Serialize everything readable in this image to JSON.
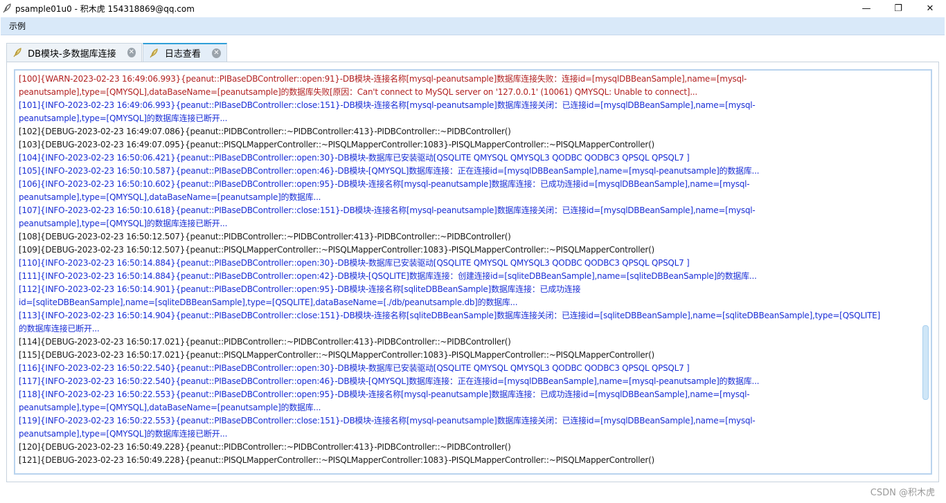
{
  "window": {
    "title": "psample01u0 - 积木虎  154318869@qq.com",
    "icon": "feather-icon",
    "controls": {
      "minimize": "—",
      "maximize": "❐",
      "close": "✕"
    }
  },
  "menubar": {
    "items": [
      {
        "label": "示例"
      }
    ]
  },
  "tabs": [
    {
      "label": "DB模块-多数据库连接",
      "icon": "feather-icon",
      "active": false
    },
    {
      "label": "日志查看",
      "icon": "feather-icon",
      "active": true
    }
  ],
  "log": {
    "lines": [
      {
        "level": "WARN",
        "text": "[100]{WARN-2023-02-23 16:49:06.993}{peanut::PIBaseDBController::open:91}-DB模块-连接名称[mysql-peanutsample]数据库连接失败：连接id=[mysqlDBBeanSample],name=[mysql-"
      },
      {
        "level": "WARN",
        "text": "peanutsample],type=[QMYSQL],dataBaseName=[peanutsample]的数据库失败[原因：Can't connect to MySQL server on '127.0.0.1' (10061) QMYSQL: Unable to connect]..."
      },
      {
        "level": "INFO",
        "text": "[101]{INFO-2023-02-23 16:49:06.993}{peanut::PIBaseDBController::close:151}-DB模块-连接名称[mysql-peanutsample]数据库连接关闭：已连接id=[mysqlDBBeanSample],name=[mysql-"
      },
      {
        "level": "INFO",
        "text": "peanutsample],type=[QMYSQL]的数据库连接已断开..."
      },
      {
        "level": "DEBUG",
        "text": "[102]{DEBUG-2023-02-23 16:49:07.086}{peanut::PIDBController::~PIDBController:413}-PIDBController::~PIDBController()"
      },
      {
        "level": "DEBUG",
        "text": "[103]{DEBUG-2023-02-23 16:49:07.095}{peanut::PISQLMapperController::~PISQLMapperController:1083}-PISQLMapperController::~PISQLMapperController()"
      },
      {
        "level": "INFO",
        "text": "[104]{INFO-2023-02-23 16:50:06.421}{peanut::PIBaseDBController::open:30}-DB模块-数据库已安装驱动[QSQLITE QMYSQL QMYSQL3 QODBC QODBC3 QPSQL QPSQL7 ]"
      },
      {
        "level": "INFO",
        "text": "[105]{INFO-2023-02-23 16:50:10.587}{peanut::PIBaseDBController::open:46}-DB模块-[QMYSQL]数据库连接：正在连接id=[mysqlDBBeanSample],name=[mysql-peanutsample]的数据库..."
      },
      {
        "level": "INFO",
        "text": "[106]{INFO-2023-02-23 16:50:10.602}{peanut::PIBaseDBController::open:95}-DB模块-连接名称[mysql-peanutsample]数据库连接：已成功连接id=[mysqlDBBeanSample],name=[mysql-"
      },
      {
        "level": "INFO",
        "text": "peanutsample],type=[QMYSQL],dataBaseName=[peanutsample]的数据库..."
      },
      {
        "level": "INFO",
        "text": "[107]{INFO-2023-02-23 16:50:10.618}{peanut::PIBaseDBController::close:151}-DB模块-连接名称[mysql-peanutsample]数据库连接关闭：已连接id=[mysqlDBBeanSample],name=[mysql-"
      },
      {
        "level": "INFO",
        "text": "peanutsample],type=[QMYSQL]的数据库连接已断开..."
      },
      {
        "level": "DEBUG",
        "text": "[108]{DEBUG-2023-02-23 16:50:12.507}{peanut::PIDBController::~PIDBController:413}-PIDBController::~PIDBController()"
      },
      {
        "level": "DEBUG",
        "text": "[109]{DEBUG-2023-02-23 16:50:12.507}{peanut::PISQLMapperController::~PISQLMapperController:1083}-PISQLMapperController::~PISQLMapperController()"
      },
      {
        "level": "INFO",
        "text": "[110]{INFO-2023-02-23 16:50:14.884}{peanut::PIBaseDBController::open:30}-DB模块-数据库已安装驱动[QSQLITE QMYSQL QMYSQL3 QODBC QODBC3 QPSQL QPSQL7 ]"
      },
      {
        "level": "INFO",
        "text": "[111]{INFO-2023-02-23 16:50:14.884}{peanut::PIBaseDBController::open:42}-DB模块-[QSQLITE]数据库连接：创建连接id=[sqliteDBBeanSample],name=[sqliteDBBeanSample]的数据库..."
      },
      {
        "level": "INFO",
        "text": "[112]{INFO-2023-02-23 16:50:14.901}{peanut::PIBaseDBController::open:95}-DB模块-连接名称[sqliteDBBeanSample]数据库连接：已成功连接"
      },
      {
        "level": "INFO",
        "text": "id=[sqliteDBBeanSample],name=[sqliteDBBeanSample],type=[QSQLITE],dataBaseName=[./db/peanutsample.db]的数据库..."
      },
      {
        "level": "INFO",
        "text": "[113]{INFO-2023-02-23 16:50:14.904}{peanut::PIBaseDBController::close:151}-DB模块-连接名称[sqliteDBBeanSample]数据库连接关闭：已连接id=[sqliteDBBeanSample],name=[sqliteDBBeanSample],type=[QSQLITE]"
      },
      {
        "level": "INFO",
        "text": "的数据库连接已断开..."
      },
      {
        "level": "DEBUG",
        "text": "[114]{DEBUG-2023-02-23 16:50:17.021}{peanut::PIDBController::~PIDBController:413}-PIDBController::~PIDBController()"
      },
      {
        "level": "DEBUG",
        "text": "[115]{DEBUG-2023-02-23 16:50:17.021}{peanut::PISQLMapperController::~PISQLMapperController:1083}-PISQLMapperController::~PISQLMapperController()"
      },
      {
        "level": "INFO",
        "text": "[116]{INFO-2023-02-23 16:50:22.540}{peanut::PIBaseDBController::open:30}-DB模块-数据库已安装驱动[QSQLITE QMYSQL QMYSQL3 QODBC QODBC3 QPSQL QPSQL7 ]"
      },
      {
        "level": "INFO",
        "text": "[117]{INFO-2023-02-23 16:50:22.540}{peanut::PIBaseDBController::open:46}-DB模块-[QMYSQL]数据库连接：正在连接id=[mysqlDBBeanSample],name=[mysql-peanutsample]的数据库..."
      },
      {
        "level": "INFO",
        "text": "[118]{INFO-2023-02-23 16:50:22.553}{peanut::PIBaseDBController::open:95}-DB模块-连接名称[mysql-peanutsample]数据库连接：已成功连接id=[mysqlDBBeanSample],name=[mysql-"
      },
      {
        "level": "INFO",
        "text": "peanutsample],type=[QMYSQL],dataBaseName=[peanutsample]的数据库..."
      },
      {
        "level": "INFO",
        "text": "[119]{INFO-2023-02-23 16:50:22.553}{peanut::PIBaseDBController::close:151}-DB模块-连接名称[mysql-peanutsample]数据库连接关闭：已连接id=[mysqlDBBeanSample],name=[mysql-"
      },
      {
        "level": "INFO",
        "text": "peanutsample],type=[QMYSQL]的数据库连接已断开..."
      },
      {
        "level": "DEBUG",
        "text": "[120]{DEBUG-2023-02-23 16:50:49.228}{peanut::PIDBController::~PIDBController:413}-PIDBController::~PIDBController()"
      },
      {
        "level": "DEBUG",
        "text": "[121]{DEBUG-2023-02-23 16:50:49.228}{peanut::PISQLMapperController::~PISQLMapperController:1083}-PISQLMapperController::~PISQLMapperController()"
      }
    ]
  },
  "colors": {
    "warn": "#b22222",
    "info": "#1a2fd6",
    "debug": "#1a1a1a",
    "menubar": "#d9e9f9",
    "tab_accent": "#2f9fd8"
  },
  "watermark": "CSDN @积木虎"
}
